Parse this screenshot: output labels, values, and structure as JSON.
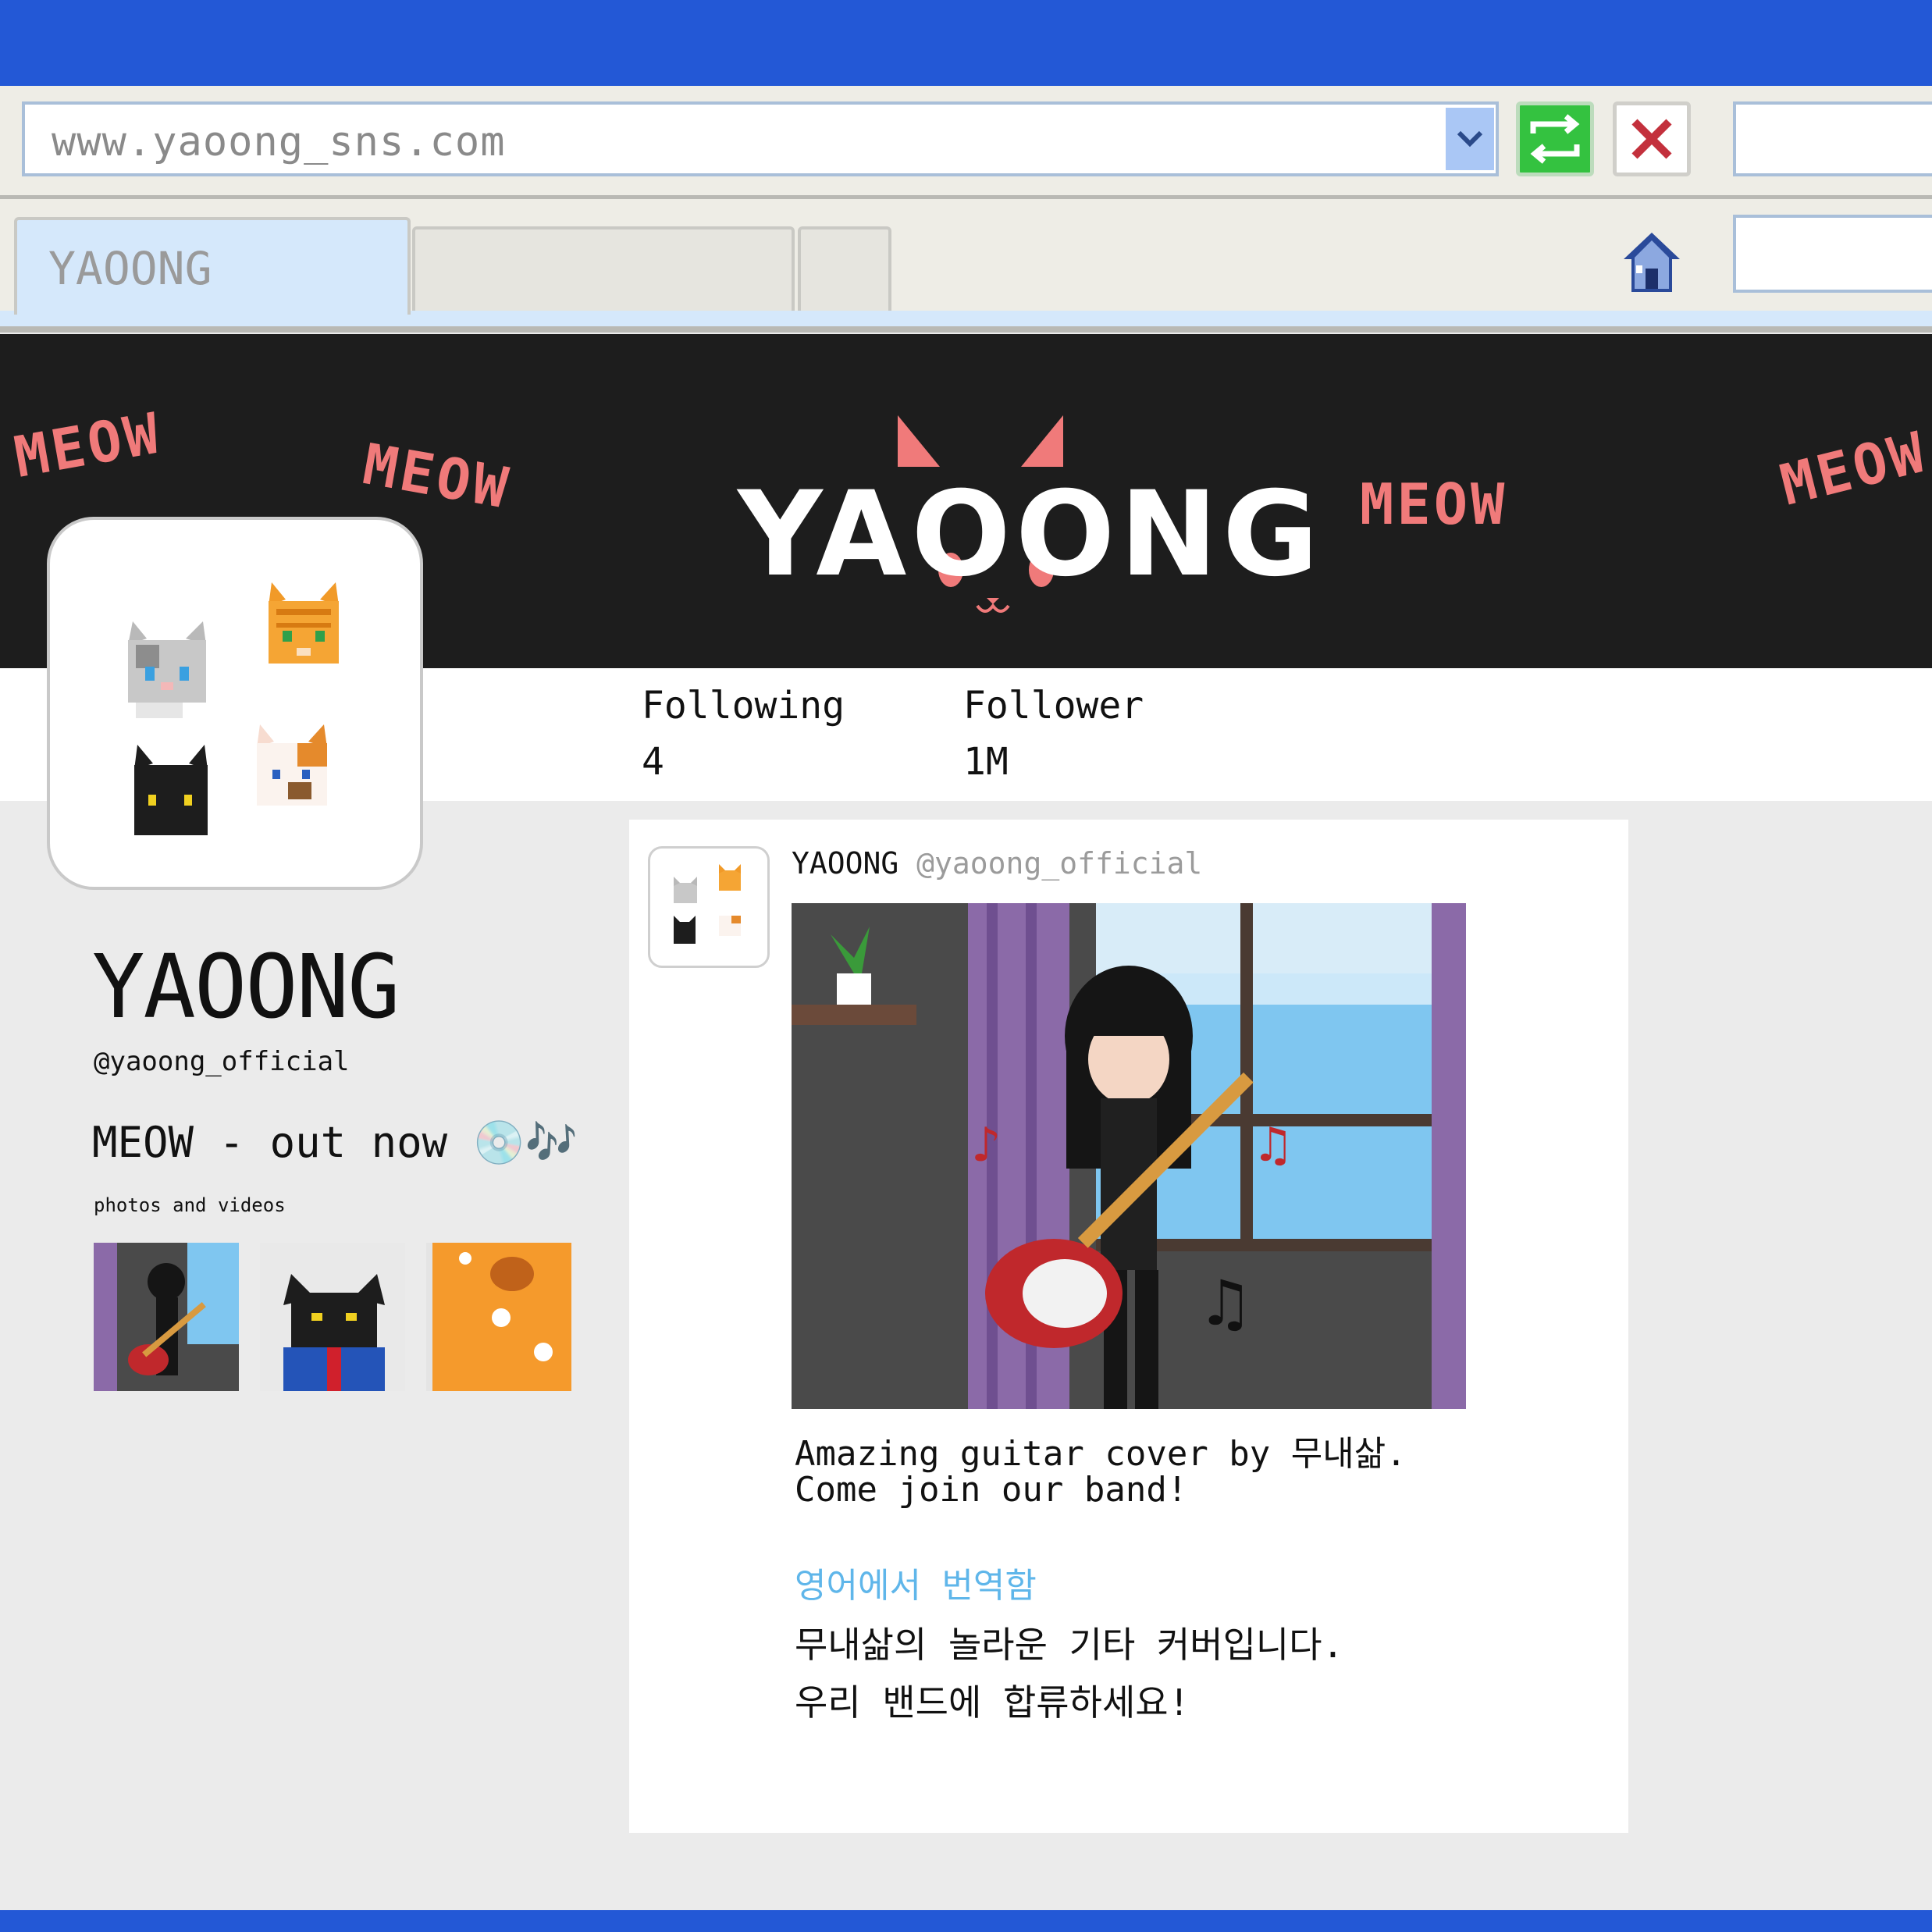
{
  "browser": {
    "url": "www.yaoong_sns.com",
    "active_tab_label": "YAOONG",
    "icons": {
      "dropdown": "chevron-down-icon",
      "refresh": "refresh-icon",
      "stop": "close-icon",
      "home": "home-icon"
    },
    "colors": {
      "top_bar": "#2358d6",
      "refresh": "#34c240",
      "stop": "#c3303c"
    }
  },
  "banner": {
    "logo": "YAOONG",
    "repeated_text": "MEOW",
    "colors": {
      "background": "#1d1d1d",
      "accent": "#f07a7a"
    }
  },
  "profile": {
    "name": "YAOONG",
    "handle": "@yaoong_official",
    "bio": "MEOW - out now 💿🎶",
    "following_label": "Following",
    "following_count": "4",
    "follower_label": "Follower",
    "follower_count": "1M",
    "media_label": "photos and videos"
  },
  "post": {
    "author": "YAOONG",
    "handle": "@yaoong_official",
    "text_line1": "Amazing guitar cover by 무내삶.",
    "text_line2": "Come join our band!",
    "translate_label": "영어에서 번역함",
    "translation_line1": "무내삶의 놀라운 기타 커버입니다.",
    "translation_line2": "우리 밴드에 합류하세요!"
  }
}
